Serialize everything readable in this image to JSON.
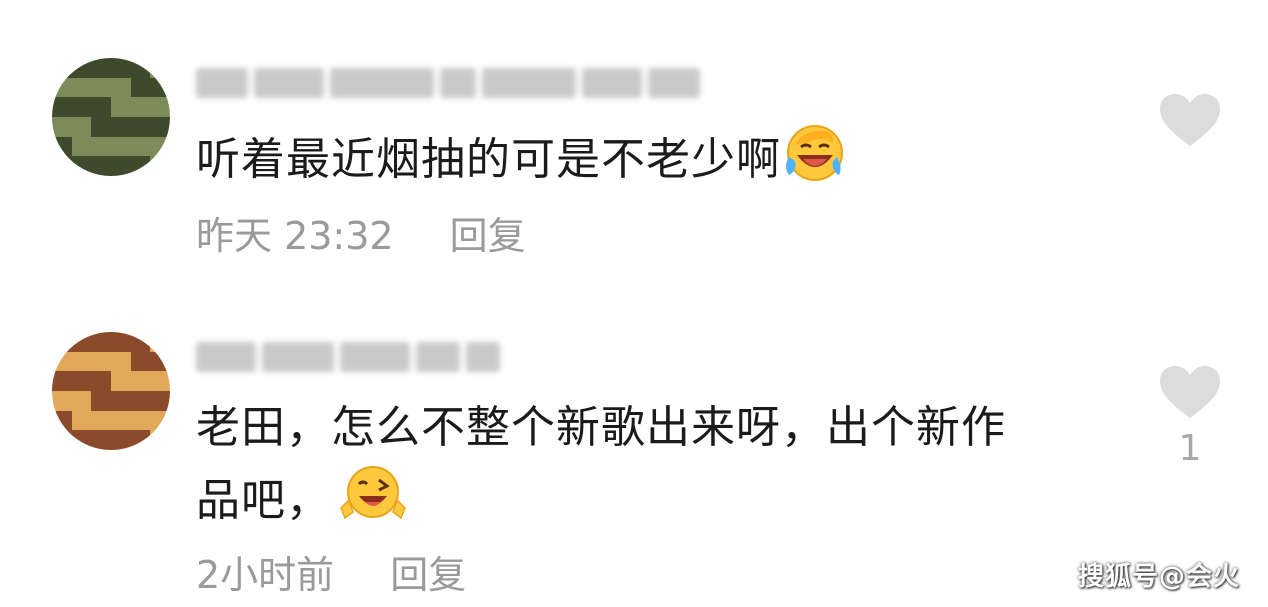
{
  "comments": [
    {
      "text": "听着最近烟抽的可是不老少啊",
      "emoji": "laughing-crying-emoji",
      "time": "昨天 23:32",
      "reply_label": "回复",
      "like_count": ""
    },
    {
      "text_line1": "老田，怎么不整个新歌出来呀，出个新作",
      "text_line2": "品吧，",
      "emoji": "winking-emoji",
      "time": "2小时前",
      "reply_label": "回复",
      "like_count": "1"
    }
  ],
  "watermark": "搜狐号@会火",
  "colors": {
    "text": "#1b1b1b",
    "meta": "#9a9a9a",
    "heart": "#dcdcdc"
  }
}
